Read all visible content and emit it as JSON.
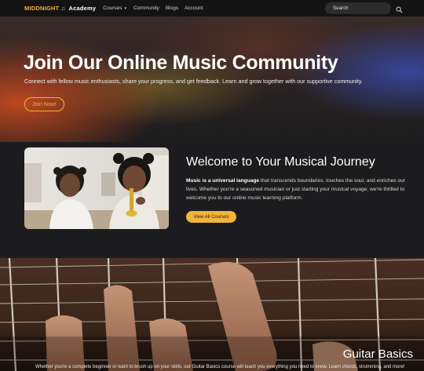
{
  "navbar": {
    "brand_part1": "MIDDNIGHT",
    "brand_note": "♫",
    "brand_part2": "Academy",
    "links": [
      "Courses",
      "Community",
      "Blogs",
      "Account"
    ],
    "search_placeholder": "Search"
  },
  "hero": {
    "title": "Join Our Online Music Community",
    "subtitle": "Connect with fellow music enthusiasts, share your progress, and get feedback. Learn and grow together with our supportive community.",
    "cta_label": "Join Now!"
  },
  "welcome": {
    "title": "Welcome to Your Musical Journey",
    "desc_bold": "Music is a universal language",
    "desc_rest": " that transcends boundaries, touches the soul, and enriches our lives. Whether you're a seasoned musician or just starting your musical voyage, we're thrilled to welcome you to our online music learning platform.",
    "button_label": "View All Courses"
  },
  "guitar": {
    "title": "Guitar Basics",
    "desc": "Whether you're a complete beginner or want to brush up on your skills, our Guitar Basics course will teach you everything you need to know. Learn chords, strumming, and more!"
  },
  "colors": {
    "accent": "#f2b43a",
    "navbar_bg": "#131314",
    "page_bg": "#1c1c1e"
  }
}
